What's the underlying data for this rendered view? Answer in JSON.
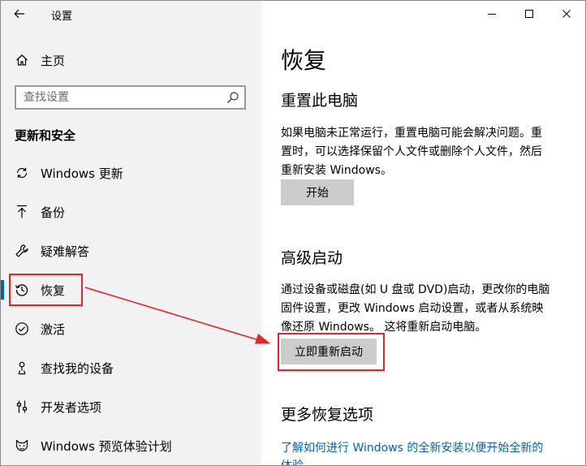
{
  "titlebar": {
    "app_title": "设置"
  },
  "sidebar": {
    "home_label": "主页",
    "search_placeholder": "查找设置",
    "section_header": "更新和安全",
    "items": [
      {
        "label": "Windows 更新"
      },
      {
        "label": "备份"
      },
      {
        "label": "疑难解答"
      },
      {
        "label": "恢复"
      },
      {
        "label": "激活"
      },
      {
        "label": "查找我的设备"
      },
      {
        "label": "开发者选项"
      },
      {
        "label": "Windows 预览体验计划"
      }
    ]
  },
  "main": {
    "title": "恢复",
    "reset": {
      "heading": "重置此电脑",
      "line1": "如果电脑未正常运行，重置电脑可能会解决问题。重",
      "line2": "置时，可以选择保留个人文件或删除个人文件，然后",
      "line3": "重新安装 Windows。",
      "button": "开始"
    },
    "advanced": {
      "heading": "高级启动",
      "line1": "通过设备或磁盘(如 U 盘或 DVD)启动，更改你的电脑",
      "line2": "固件设置，更改 Windows 启动设置，或者从系统映",
      "line3": "像还原 Windows。  这将重新启动电脑。",
      "button": "立即重新启动"
    },
    "more": {
      "heading": "更多恢复选项",
      "link_line1": "了解如何进行 Windows 的全新安装以便开始全新的",
      "link_line2": "体验"
    }
  },
  "colors": {
    "accent": "#0063b1",
    "annotation_red": "#e3262b",
    "sidebar_bg": "#f2f2f2",
    "button_bg": "#cccccc"
  }
}
